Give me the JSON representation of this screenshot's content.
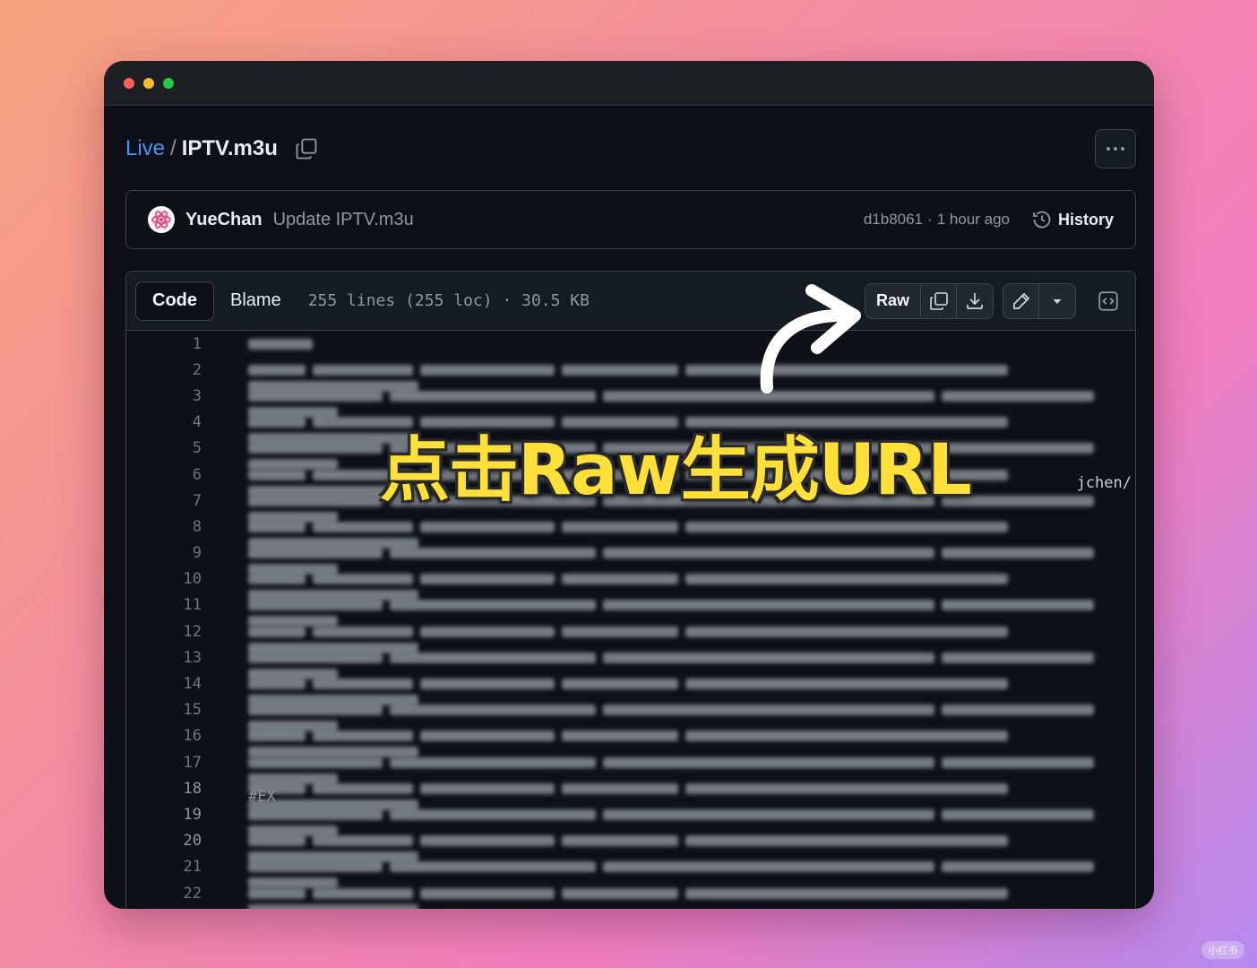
{
  "breadcrumb": {
    "repo": "Live",
    "separator": "/",
    "file": "IPTV.m3u"
  },
  "commit": {
    "author": "YueChan",
    "message": "Update IPTV.m3u",
    "sha": "d1b8061",
    "separator": "·",
    "time": "1 hour ago",
    "history_label": "History"
  },
  "file_header": {
    "tabs": [
      {
        "label": "Code",
        "active": true
      },
      {
        "label": "Blame",
        "active": false
      }
    ],
    "meta": "255 lines (255 loc) · 30.5 KB",
    "raw_label": "Raw"
  },
  "code": {
    "line_numbers": [
      "1",
      "2",
      "3",
      "4",
      "5",
      "6",
      "7",
      "8",
      "9",
      "10",
      "11",
      "12",
      "13",
      "14",
      "15",
      "16",
      "17",
      "18",
      "19",
      "20",
      "21",
      "22"
    ],
    "visible_fragment_line6": "jchen/",
    "visible_prefix_line18": "#EX"
  },
  "annotation": {
    "text": "点击Raw生成URL"
  },
  "colors": {
    "link": "#4493f8",
    "annotation": "#ffe03a",
    "background_dark": "#0d1117"
  },
  "watermark": "小红书"
}
